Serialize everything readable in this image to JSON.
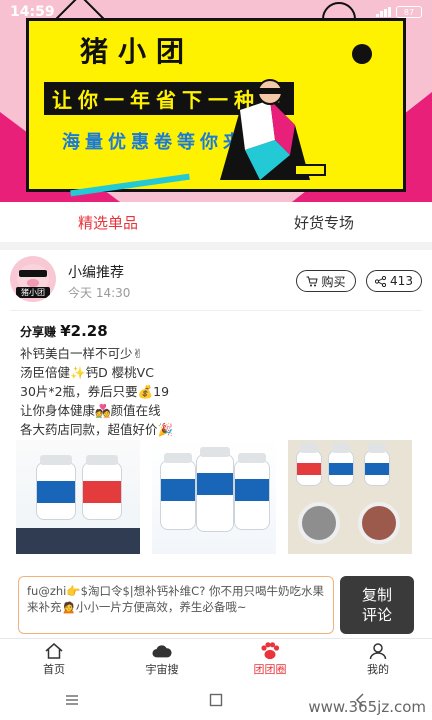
{
  "status_bar": {
    "time": "14:59",
    "battery": "87"
  },
  "banner": {
    "title": "猪小团",
    "line1": "让你一年省下一种芽",
    "line2": "海量优惠卷等你来领取"
  },
  "tabs": [
    {
      "label": "精选单品",
      "active": true
    },
    {
      "label": "好货专场",
      "active": false
    }
  ],
  "post": {
    "avatar_label": "猪小团",
    "author": "小编推荐",
    "time": "今天 14:30",
    "buy_label": "购买",
    "share_count": "413",
    "earn_prefix": "分享赚",
    "earn_amount": "¥2.28",
    "lines": [
      "补钙美白一样不可少✌",
      "汤臣倍健✨钙D 樱桃VC",
      "30片*2瓶，券后只要💰19",
      "让你身体健康💑颜值在线",
      "各大药店同款，超值好价🎉"
    ]
  },
  "comment": {
    "text": "fu@zhi👉$淘口令$|想补钙补维C? 你不用只喝牛奶吃水果来补充🙍小小一片方便高效，养生必备哦~"
  },
  "copy_button": {
    "line1": "复制",
    "line2": "评论"
  },
  "bottom_nav": [
    {
      "label": "首页",
      "icon": "home-icon",
      "active": false
    },
    {
      "label": "宇宙搜",
      "icon": "cloud-icon",
      "active": false
    },
    {
      "label": "团团圈",
      "icon": "paw-icon",
      "active": true
    },
    {
      "label": "我的",
      "icon": "user-icon",
      "active": false
    }
  ],
  "watermark": "www.365jz.com",
  "colors": {
    "accent": "#e8343a",
    "banner_yellow": "#fff200",
    "banner_pink": "#e8207a",
    "dark_button": "#3a3a3a"
  }
}
